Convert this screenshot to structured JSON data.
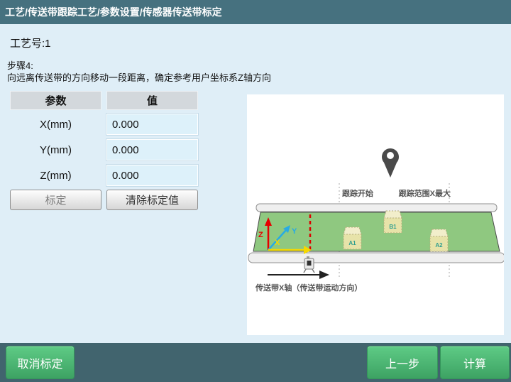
{
  "titlebar": {
    "breadcrumb": "工艺/传送带跟踪工艺/参数设置/传感器传送带标定"
  },
  "main": {
    "process_no": "工艺号:1",
    "step_title": "步骤4:",
    "step_desc": "向远离传送带的方向移动一段距离，确定参考用户坐标系Z轴方向",
    "table": {
      "headers": [
        "参数",
        "值"
      ],
      "rows": [
        {
          "label": "X(mm)",
          "value": "0.000"
        },
        {
          "label": "Y(mm)",
          "value": "0.000"
        },
        {
          "label": "Z(mm)",
          "value": "0.000"
        }
      ]
    },
    "calibrate_label": "标定",
    "clear_label": "清除标定值"
  },
  "diagram": {
    "tracking_start_label": "跟踪开始",
    "tracking_max_label": "跟踪范围X最大",
    "conveyor_axis_label": "传送带X轴（传送带运动方向）",
    "boxes": [
      "A1",
      "B1",
      "A2"
    ],
    "axes": {
      "x": "X",
      "y": "Y",
      "z": "Z"
    },
    "colors": {
      "belt_green": "#8fc880",
      "box_fill": "#e7e3a9",
      "box_top": "#f2eecb",
      "box_label": "#2f9e8f",
      "pin_gray": "#4a4a4a",
      "axis_x": "#f5d800",
      "axis_y": "#29abe2",
      "axis_z": "#e60000",
      "marker_red": "#dd0000"
    }
  },
  "footer": {
    "cancel_label": "取消标定",
    "prev_label": "上一步",
    "calc_label": "计算"
  },
  "colors": {
    "titlebar_bg": "#46717f",
    "main_bg": "#dfeef7",
    "footer_bg": "#41646e",
    "header_cell_bg": "#d3d8dc",
    "value_field_bg": "#ddf1fa",
    "green_button": "#44b872"
  }
}
